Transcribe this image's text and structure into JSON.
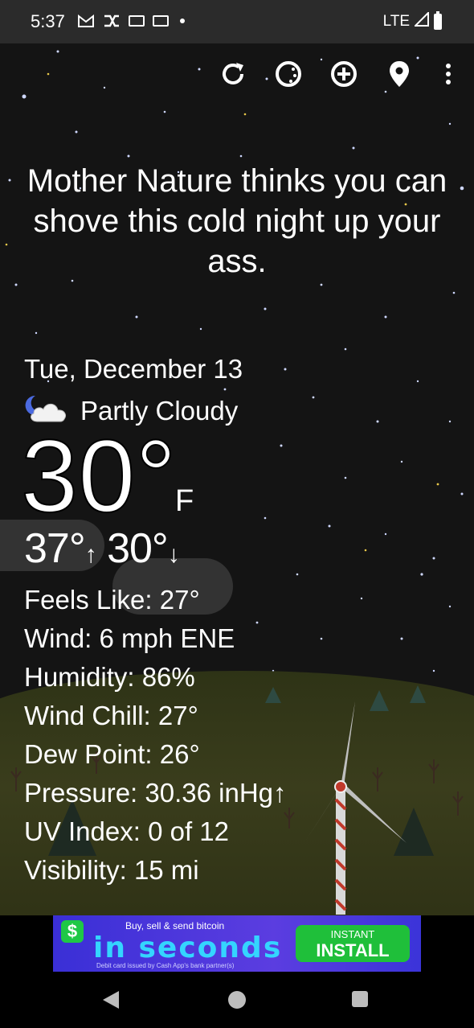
{
  "status_bar": {
    "time": "5:37",
    "icons": [
      "gmail-icon",
      "shuffle-icon",
      "card-icon",
      "card-icon"
    ],
    "network": "LTE"
  },
  "toolbar": {
    "icons": [
      "refresh-icon",
      "theme-icon",
      "add-location-icon",
      "location-pin-icon",
      "more-vert-icon"
    ]
  },
  "quote": "Mother Nature thinks you can shove this cold night up your ass.",
  "weather": {
    "date": "Tue, December 13",
    "condition": "Partly Cloudy",
    "condition_icon": "partly-cloudy-night-icon",
    "temperature": "30°",
    "unit": "F",
    "high": "37°",
    "low": "30°",
    "details": [
      {
        "label": "Feels Like:",
        "value": "27°"
      },
      {
        "label": "Wind:",
        "value": "6 mph ENE"
      },
      {
        "label": "Humidity:",
        "value": "86%"
      },
      {
        "label": "Wind Chill:",
        "value": "27°"
      },
      {
        "label": "Dew Point:",
        "value": "26°"
      },
      {
        "label": "Pressure:",
        "value": "30.36 inHg↑"
      },
      {
        "label": "UV Index:",
        "value": "0 of 12"
      },
      {
        "label": "Visibility:",
        "value": "15 mi"
      }
    ]
  },
  "ad": {
    "top_line": "Buy, sell & send bitcoin",
    "headline": "in seconds",
    "fine_print": "Debit card issued by Cash App's bank partner(s)",
    "button_line1": "INSTANT",
    "button_line2": "INSTALL",
    "logo_symbol": "$"
  },
  "colors": {
    "sky": "#141414",
    "status_bar": "#2b2b2b",
    "ad_background": "#4a37dc",
    "ad_button": "#1fbf3a"
  }
}
